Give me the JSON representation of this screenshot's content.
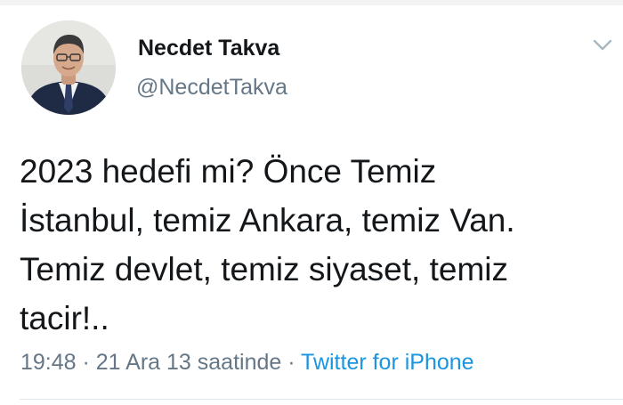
{
  "tweet": {
    "author": {
      "name": "Necdet Takva",
      "handle": "@NecdetTakva",
      "avatar_icon": "profile-photo"
    },
    "text_lines": [
      "2023 hedefi mi? Önce Temiz",
      "İstanbul, temiz Ankara, temiz Van.",
      "Temiz devlet, temiz siyaset, temiz",
      "tacir!.."
    ],
    "meta": {
      "time": "19:48",
      "separator": " · ",
      "date": "21 Ara 13 saatinde",
      "source": "Twitter for iPhone"
    },
    "menu_icon": "chevron-down-icon"
  },
  "colors": {
    "text": "#14171a",
    "secondary": "#657786",
    "link": "#1b95e0",
    "divider": "#e1e8ed"
  }
}
